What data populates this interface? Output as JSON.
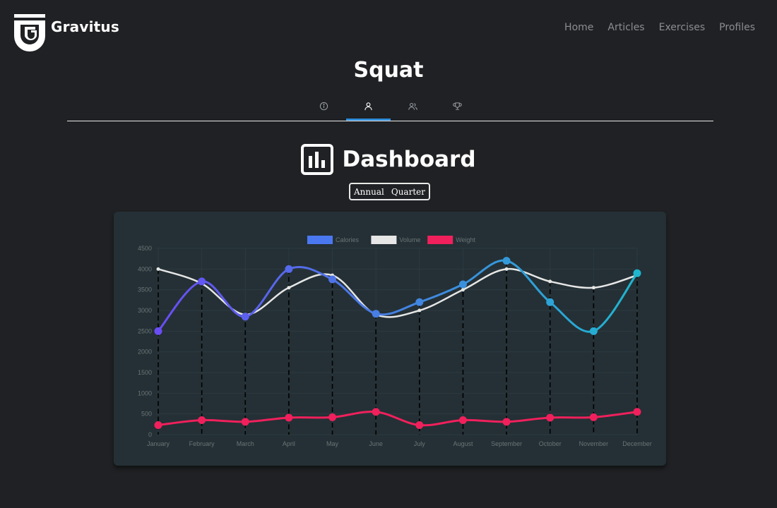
{
  "header": {
    "brand": "Gravitus",
    "nav": [
      "Home",
      "Articles",
      "Exercises",
      "Profiles"
    ]
  },
  "page": {
    "title": "Squat",
    "tabs": [
      {
        "icon": "info-icon",
        "active": false
      },
      {
        "icon": "user-icon",
        "active": true
      },
      {
        "icon": "users-icon",
        "active": false
      },
      {
        "icon": "trophy-icon",
        "active": false
      }
    ]
  },
  "dashboard": {
    "title": "Dashboard",
    "icon": "bar-chart-icon",
    "period_options": [
      "Annual",
      "Quarter"
    ]
  },
  "colors": {
    "background": "#202124",
    "card": "#243035",
    "calories": "#4a78f0",
    "volume": "#e6e6e6",
    "weight": "#f0205c",
    "active_tab": "#2f8fdc"
  },
  "chart_data": {
    "type": "line",
    "categories": [
      "January",
      "February",
      "March",
      "April",
      "May",
      "June",
      "July",
      "August",
      "September",
      "October",
      "November",
      "December"
    ],
    "series": [
      {
        "name": "Calories",
        "values": [
          2500,
          3700,
          2850,
          4000,
          3750,
          2920,
          3200,
          3630,
          4200,
          3200,
          2500,
          3900
        ],
        "gradient": [
          "#6a4df5",
          "#1fb6cf"
        ]
      },
      {
        "name": "Volume",
        "values": [
          4000,
          3650,
          2900,
          3550,
          3850,
          2900,
          3000,
          3500,
          4000,
          3700,
          3550,
          3850
        ]
      },
      {
        "name": "Weight",
        "values": [
          230,
          350,
          310,
          410,
          420,
          550,
          230,
          350,
          310,
          410,
          420,
          550
        ]
      }
    ],
    "yticks": [
      0,
      500,
      1000,
      1500,
      2000,
      2500,
      3000,
      3500,
      4000,
      4500
    ],
    "ylim": [
      0,
      4500
    ],
    "legend_position": "top-center",
    "grid": true,
    "dashed_drop_lines": true
  }
}
